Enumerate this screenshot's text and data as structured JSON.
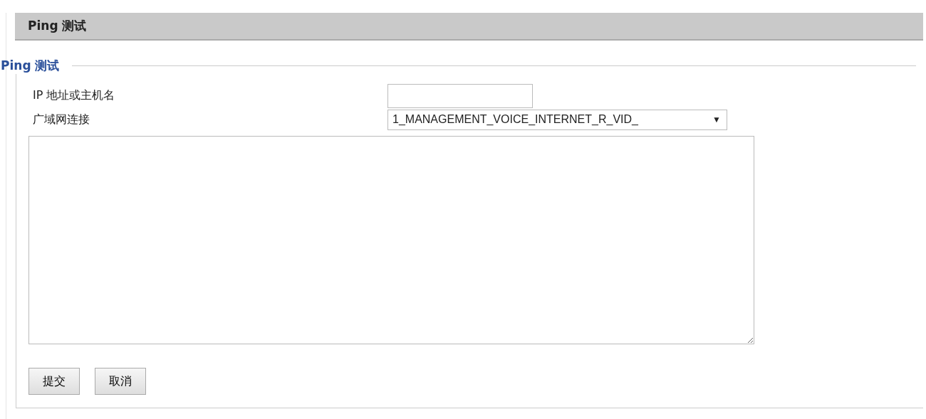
{
  "header": {
    "title": "Ping 测试"
  },
  "section": {
    "legend": "Ping 测试"
  },
  "fields": [
    {
      "kind": "text",
      "label": "IP 地址或主机名"
    },
    {
      "kind": "select",
      "label": "广域网连接",
      "value": "1_MANAGEMENT_VOICE_INTERNET_R_VID_",
      "arrow": "▼"
    }
  ],
  "buttons": [
    "提交",
    "取消"
  ]
}
